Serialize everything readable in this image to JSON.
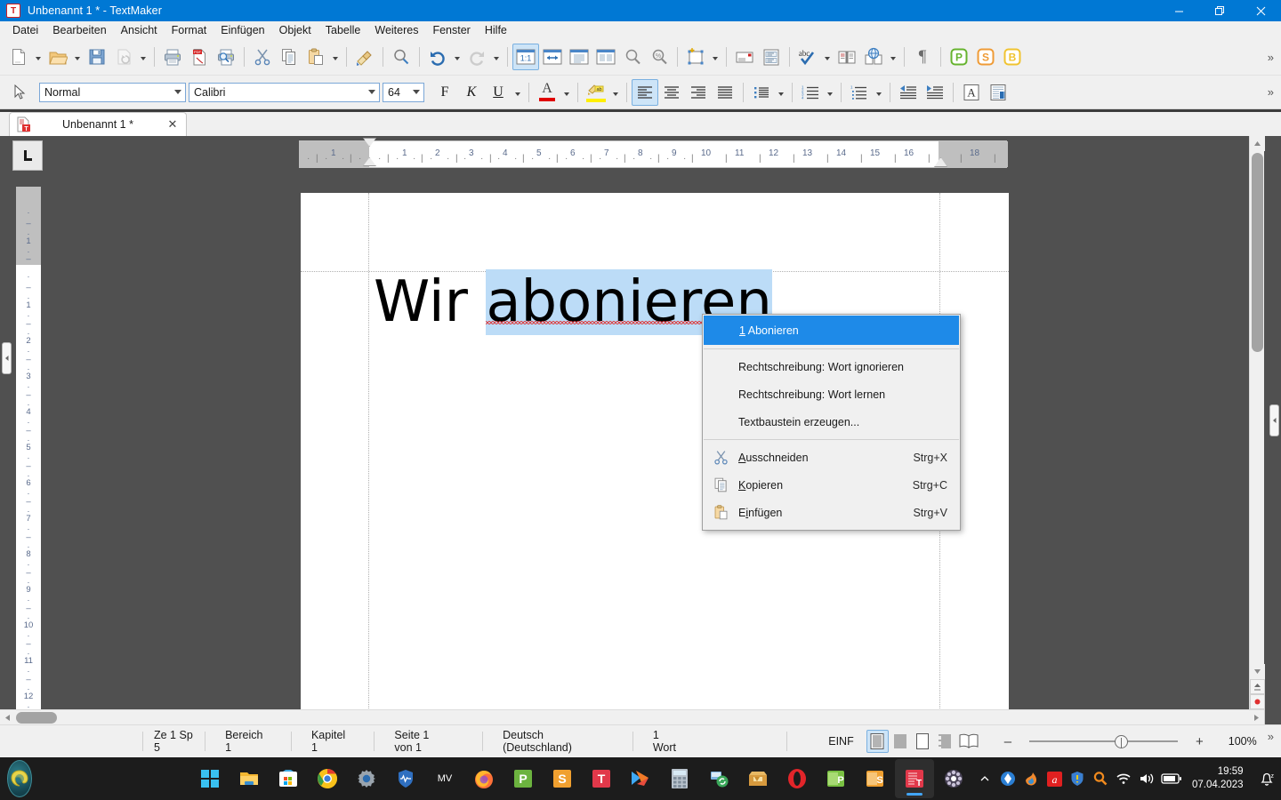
{
  "window": {
    "title": "Unbenannt 1 * - TextMaker",
    "app_icon": "textmaker-icon",
    "minimize_label": "—",
    "maximize_label": "❐",
    "close_label": "✕"
  },
  "menubar": {
    "items": [
      {
        "label": "Datei",
        "name": "menu-datei"
      },
      {
        "label": "Bearbeiten",
        "name": "menu-bearbeiten"
      },
      {
        "label": "Ansicht",
        "name": "menu-ansicht"
      },
      {
        "label": "Format",
        "name": "menu-format"
      },
      {
        "label": "Einfügen",
        "name": "menu-einfuegen"
      },
      {
        "label": "Objekt",
        "name": "menu-objekt"
      },
      {
        "label": "Tabelle",
        "name": "menu-tabelle"
      },
      {
        "label": "Weiteres",
        "name": "menu-weiteres"
      },
      {
        "label": "Fenster",
        "name": "menu-fenster"
      },
      {
        "label": "Hilfe",
        "name": "menu-hilfe"
      }
    ]
  },
  "toolbar_main": {
    "overflow_label": "»",
    "buttons": [
      {
        "name": "new-document-icon",
        "glyph": "doc"
      },
      {
        "name": "open-file-icon",
        "glyph": "folder"
      },
      {
        "name": "save-icon",
        "glyph": "save"
      },
      {
        "name": "revert-icon",
        "glyph": "revert",
        "disabled": true
      },
      {
        "name": "print-icon",
        "glyph": "printer"
      },
      {
        "name": "export-pdf-icon",
        "glyph": "pdf"
      },
      {
        "name": "print-preview-icon",
        "glyph": "printpreview"
      },
      {
        "name": "cut-icon",
        "glyph": "scissors"
      },
      {
        "name": "copy-icon",
        "glyph": "copy"
      },
      {
        "name": "paste-icon",
        "glyph": "paste"
      },
      {
        "name": "format-painter-icon",
        "glyph": "brush"
      },
      {
        "name": "search-icon",
        "glyph": "magnifier"
      },
      {
        "name": "undo-icon",
        "glyph": "undo"
      },
      {
        "name": "redo-icon",
        "glyph": "redo",
        "disabled": true
      },
      {
        "name": "zoom-100-icon",
        "glyph": "onetoone",
        "label": "1:1",
        "active": true
      },
      {
        "name": "fit-page-width-icon",
        "glyph": "fitwidth"
      },
      {
        "name": "whole-page-icon",
        "glyph": "wholepage"
      },
      {
        "name": "two-pages-icon",
        "glyph": "twopages"
      },
      {
        "name": "zoom-in-icon",
        "glyph": "zoomin"
      },
      {
        "name": "zoom-percent-icon",
        "glyph": "zoompct"
      },
      {
        "name": "insert-object-icon",
        "glyph": "objectframe"
      },
      {
        "name": "envelope-icon",
        "glyph": "envelope"
      },
      {
        "name": "labels-icon",
        "glyph": "labels"
      },
      {
        "name": "spellcheck-icon",
        "glyph": "abccheck",
        "label": "abc"
      },
      {
        "name": "thesaurus-icon",
        "glyph": "book"
      },
      {
        "name": "translate-icon",
        "glyph": "globebook"
      },
      {
        "name": "formatting-marks-icon",
        "glyph": "pilcrow"
      },
      {
        "name": "planmaker-icon",
        "glyph": "letterbox",
        "label": "P",
        "color": "#5aa82e"
      },
      {
        "name": "presentations-icon",
        "glyph": "letterbox",
        "label": "S",
        "color": "#e8922c"
      },
      {
        "name": "basicmaker-icon",
        "glyph": "letterbox",
        "label": "B",
        "color": "#e8c02c"
      }
    ]
  },
  "toolbar_format": {
    "overflow_label": "»",
    "pointer_icon": "cursor-arrow-icon",
    "style_combo": {
      "name": "paragraph-style-combo",
      "value": "Normal"
    },
    "font_combo": {
      "name": "font-family-combo",
      "value": "Calibri"
    },
    "size_combo": {
      "name": "font-size-combo",
      "value": "64"
    },
    "bold_label": "F",
    "italic_label": "K",
    "underline_label": "U",
    "font_color_label": "A",
    "highlight_label": "ab",
    "buttons": [
      {
        "name": "align-left-icon",
        "active": true
      },
      {
        "name": "align-center-icon"
      },
      {
        "name": "align-right-icon"
      },
      {
        "name": "align-justify-icon"
      },
      {
        "name": "bullet-list-icon"
      },
      {
        "name": "numbered-list-icon"
      },
      {
        "name": "outline-list-icon"
      },
      {
        "name": "decrease-indent-icon"
      },
      {
        "name": "increase-indent-icon"
      },
      {
        "name": "character-format-icon",
        "label": "A"
      },
      {
        "name": "paragraph-format-icon"
      }
    ]
  },
  "document_tab": {
    "label": "Unbenannt 1 *",
    "close_label": "✕",
    "icon": "document-icon"
  },
  "ruler": {
    "corner_tab_icon": "tab-stop-left-icon",
    "horizontal_marks": [
      "1",
      "1",
      "2",
      "3",
      "4",
      "5",
      "6",
      "7",
      "8",
      "9",
      "10",
      "11",
      "12",
      "13",
      "14",
      "15",
      "16",
      "18"
    ],
    "vertical_marks": [
      "1",
      "1",
      "2",
      "3",
      "4",
      "5",
      "6",
      "7",
      "8",
      "9",
      "10",
      "11",
      "12",
      "13"
    ]
  },
  "document": {
    "text_before": "Wir ",
    "text_selected": "abonieren",
    "selection_color": "#bcdcf7",
    "misspelling_underline_color": "#e03131",
    "font": "Calibri",
    "size": "64"
  },
  "context_menu": {
    "items": [
      {
        "name": "suggestion-abonieren",
        "label": "1 Abonieren",
        "accel": "",
        "icon": "",
        "highlight": true,
        "mnemonic": "1"
      },
      {
        "name": "spelling-ignore-word",
        "label": "Rechtschreibung: Wort ignorieren",
        "accel": "",
        "icon": ""
      },
      {
        "name": "spelling-learn-word",
        "label": "Rechtschreibung: Wort lernen",
        "accel": "",
        "icon": ""
      },
      {
        "name": "create-text-module",
        "label": "Textbaustein erzeugen...",
        "accel": "",
        "icon": ""
      },
      {
        "name": "cut-menu-item",
        "label": "Ausschneiden",
        "accel": "Strg+X",
        "icon": "scissors-icon"
      },
      {
        "name": "copy-menu-item",
        "label": "Kopieren",
        "accel": "Strg+C",
        "icon": "copy-icon"
      },
      {
        "name": "paste-menu-item",
        "label": "Einfügen",
        "accel": "Strg+V",
        "icon": "paste-icon"
      }
    ]
  },
  "statusbar": {
    "position": "Ze 1 Sp 5",
    "section": "Bereich 1",
    "chapter": "Kapitel 1",
    "page": "Seite 1 von 1",
    "language": "Deutsch (Deutschland)",
    "words": "1 Wort",
    "insert_mode": "EINF",
    "zoom_label": "100%",
    "zoom_minus": "–",
    "zoom_plus": "+",
    "overflow_label": "»",
    "view_buttons": [
      {
        "name": "view-normal-icon",
        "active": true
      },
      {
        "name": "view-draft-icon"
      },
      {
        "name": "view-page-layout-icon"
      },
      {
        "name": "view-outline-icon"
      },
      {
        "name": "view-book-icon"
      }
    ]
  },
  "taskbar": {
    "start_name": "start-button",
    "items": [
      {
        "name": "task-view-icon",
        "glyph": "windows"
      },
      {
        "name": "file-explorer-icon",
        "glyph": "folder"
      },
      {
        "name": "microsoft-store-icon",
        "glyph": "store"
      },
      {
        "name": "google-chrome-icon",
        "glyph": "chrome"
      },
      {
        "name": "settings-icon",
        "glyph": "gear"
      },
      {
        "name": "windows-security-icon",
        "glyph": "shield"
      },
      {
        "name": "mv-icon",
        "glyph": "mv",
        "label": "MV"
      },
      {
        "name": "firefox-icon",
        "glyph": "firefox"
      },
      {
        "name": "planmaker-taskbar-icon",
        "glyph": "tile",
        "label": "P",
        "color": "#5aa82e"
      },
      {
        "name": "presentations-taskbar-icon",
        "glyph": "tile",
        "label": "S",
        "color": "#e8922c"
      },
      {
        "name": "textmaker-taskbar-icon",
        "glyph": "tile",
        "label": "T",
        "color": "#e13a3a"
      },
      {
        "name": "media-player-icon",
        "glyph": "play"
      },
      {
        "name": "calculator-icon",
        "glyph": "calc"
      },
      {
        "name": "backup-icon",
        "glyph": "sync"
      },
      {
        "name": "archive-icon",
        "glyph": "box"
      },
      {
        "name": "opera-icon",
        "glyph": "opera"
      },
      {
        "name": "planmaker-doc-icon",
        "glyph": "tile",
        "label": "P",
        "color": "#7ac143"
      },
      {
        "name": "presentations-doc-icon",
        "glyph": "tile",
        "label": "S",
        "color": "#f0a030"
      },
      {
        "name": "textmaker-window-icon",
        "glyph": "tile",
        "label": "T",
        "color": "#e13a3a",
        "active": true
      },
      {
        "name": "media-app-icon",
        "glyph": "reel"
      }
    ],
    "tray": [
      {
        "name": "show-hidden-icons",
        "glyph": "chevron-up"
      },
      {
        "name": "tray-app-blue-icon",
        "glyph": "bluecircle"
      },
      {
        "name": "tray-app-orange-icon",
        "glyph": "flame"
      },
      {
        "name": "avira-icon",
        "glyph": "avira"
      },
      {
        "name": "security-warning-icon",
        "glyph": "shieldwarn"
      },
      {
        "name": "search-tray-icon",
        "glyph": "magnifier"
      },
      {
        "name": "wifi-icon",
        "glyph": "wifi"
      },
      {
        "name": "volume-icon",
        "glyph": "volume"
      },
      {
        "name": "battery-icon",
        "glyph": "battery"
      }
    ],
    "clock": {
      "time": "19:59",
      "date": "07.04.2023"
    },
    "notifications_icon": "notification-bell-icon"
  }
}
